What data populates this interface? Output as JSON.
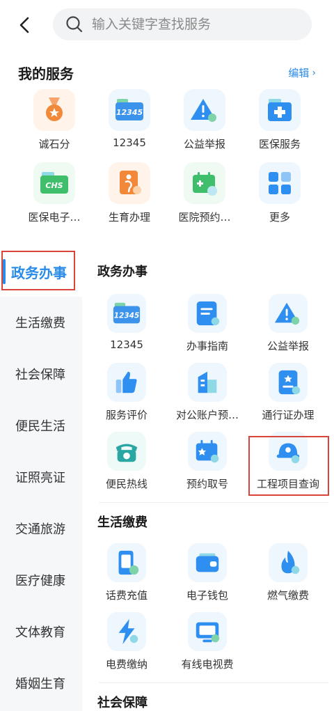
{
  "search": {
    "placeholder": "输入关键字查找服务"
  },
  "my_services": {
    "title": "我的服务",
    "edit_label": "编辑",
    "items": [
      {
        "label": "诚石分",
        "icon": "medal-icon"
      },
      {
        "label": "12345",
        "icon": "hotline-12345-icon"
      },
      {
        "label": "公益举报",
        "icon": "warning-report-icon"
      },
      {
        "label": "医保服务",
        "icon": "medical-insurance-icon"
      },
      {
        "label": "医保电子…",
        "icon": "chs-card-icon"
      },
      {
        "label": "生育办理",
        "icon": "maternity-icon"
      },
      {
        "label": "医院预约…",
        "icon": "hospital-appointment-icon"
      },
      {
        "label": "更多",
        "icon": "more-grid-icon"
      }
    ]
  },
  "sidebar": {
    "items": [
      {
        "label": "政务办事",
        "active": true
      },
      {
        "label": "生活缴费"
      },
      {
        "label": "社会保障"
      },
      {
        "label": "便民生活"
      },
      {
        "label": "证照亮证"
      },
      {
        "label": "交通旅游"
      },
      {
        "label": "医疗健康"
      },
      {
        "label": "文体教育"
      },
      {
        "label": "婚姻生育"
      }
    ]
  },
  "sections": [
    {
      "title": "政务办事",
      "items": [
        {
          "label": "12345",
          "icon": "hotline-12345-icon"
        },
        {
          "label": "办事指南",
          "icon": "guide-document-icon"
        },
        {
          "label": "公益举报",
          "icon": "warning-report-icon"
        },
        {
          "label": "服务评价",
          "icon": "thumbs-up-icon"
        },
        {
          "label": "对公账户预…",
          "icon": "bank-building-icon"
        },
        {
          "label": "通行证办理",
          "icon": "pass-document-icon"
        },
        {
          "label": "便民热线",
          "icon": "telephone-icon"
        },
        {
          "label": "预约取号",
          "icon": "calendar-ticket-icon"
        },
        {
          "label": "工程项目查询",
          "icon": "hardhat-icon"
        }
      ]
    },
    {
      "title": "生活缴费",
      "items": [
        {
          "label": "话费充值",
          "icon": "phone-recharge-icon"
        },
        {
          "label": "电子钱包",
          "icon": "wallet-icon"
        },
        {
          "label": "燃气缴费",
          "icon": "gas-flame-icon"
        },
        {
          "label": "电费缴纳",
          "icon": "lightning-icon"
        },
        {
          "label": "有线电视费",
          "icon": "tv-icon"
        }
      ]
    },
    {
      "title": "社会保障",
      "items": []
    }
  ],
  "colors": {
    "accent": "#2a8be8",
    "highlight_box": "#d9443a",
    "icon_blue": "#2f8ff0",
    "icon_orange": "#f2883a",
    "icon_green": "#3fbf6b"
  }
}
